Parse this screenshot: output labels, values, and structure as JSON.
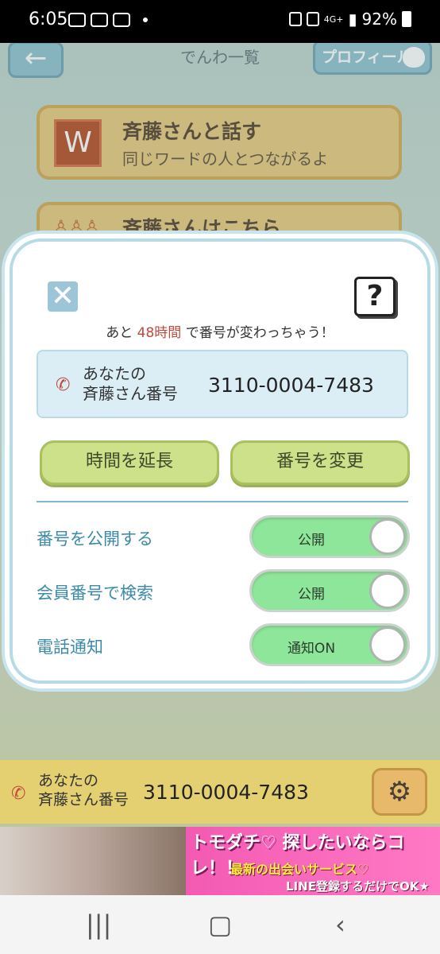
{
  "status_bar": {
    "time": "6:05",
    "network": "4G+",
    "battery": "92%"
  },
  "header": {
    "back_icon": "arrow-left-icon",
    "title": "でんわ一覧",
    "profile_label": "プロフィール"
  },
  "menu": [
    {
      "icon_text": "W",
      "title": "斉藤さんと話す",
      "subtitle": "同じワードの人とつながるよ"
    },
    {
      "icon": "people-icon",
      "title": "斉藤さんはこちら",
      "subtitle": ""
    }
  ],
  "modal": {
    "close_icon": "close-icon",
    "help_label": "?",
    "notice_prefix": "あと",
    "notice_highlight": "48時間",
    "notice_suffix": "で番号が変わっちゃう！",
    "number_label_line1": "あなたの",
    "number_label_line2": "斉藤さん番号",
    "number_value": "3110-0004-7483",
    "extend_button": "時間を延長",
    "change_button": "番号を変更",
    "settings": [
      {
        "label": "番号を公開する",
        "toggle_text": "公開",
        "on": true
      },
      {
        "label": "会員番号で検索",
        "toggle_text": "公開",
        "on": true
      },
      {
        "label": "電話通知",
        "toggle_text": "通知ON",
        "on": true
      }
    ]
  },
  "bottom_bar": {
    "label_line1": "あなたの",
    "label_line2": "斉藤さん番号",
    "number_value": "3110-0004-7483",
    "settings_icon": "gear-icon"
  },
  "ad": {
    "line1": "トモダチ♡ 探したいならコレ！！",
    "line2": "最新の出会いサービス♡",
    "line3": "LINE登録するだけでOK★"
  },
  "colors": {
    "accent_red": "#c2493e",
    "label_blue": "#3b8aa9",
    "toggle_green": "#8ee69a",
    "button_green": "#cde08a"
  }
}
